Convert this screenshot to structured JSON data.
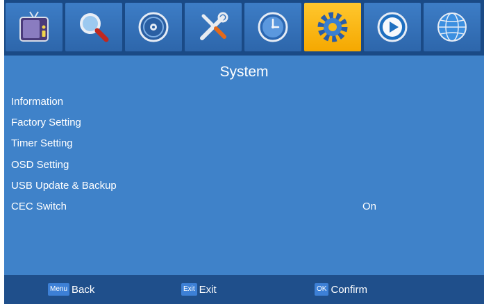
{
  "tabs": [
    {
      "icon": "tv-icon",
      "active": false
    },
    {
      "icon": "search-icon",
      "active": false
    },
    {
      "icon": "disc-icon",
      "active": false
    },
    {
      "icon": "tools-icon",
      "active": false
    },
    {
      "icon": "clock-icon",
      "active": false
    },
    {
      "icon": "gear-icon",
      "active": true
    },
    {
      "icon": "media-play-icon",
      "active": false
    },
    {
      "icon": "globe-icon",
      "active": false
    }
  ],
  "page": {
    "title": "System"
  },
  "menu": {
    "items": [
      {
        "label": "Information",
        "value": ""
      },
      {
        "label": "Factory Setting",
        "value": ""
      },
      {
        "label": "Timer Setting",
        "value": ""
      },
      {
        "label": "OSD Setting",
        "value": ""
      },
      {
        "label": "USB Update & Backup",
        "value": ""
      },
      {
        "label": "CEC Switch",
        "value": "On"
      }
    ]
  },
  "footer": {
    "menu_key": "Menu",
    "menu_label": "Back",
    "exit_key": "Exit",
    "exit_label": "Exit",
    "ok_key": "OK",
    "ok_label": "Confirm"
  },
  "colors": {
    "background": "#3f82c9",
    "icon_bar": "#1a4a86",
    "tile": "#3470b7",
    "active_tile": "#ffc72e",
    "footer": "#1f4f8b",
    "key_badge": "#3d80d6"
  }
}
